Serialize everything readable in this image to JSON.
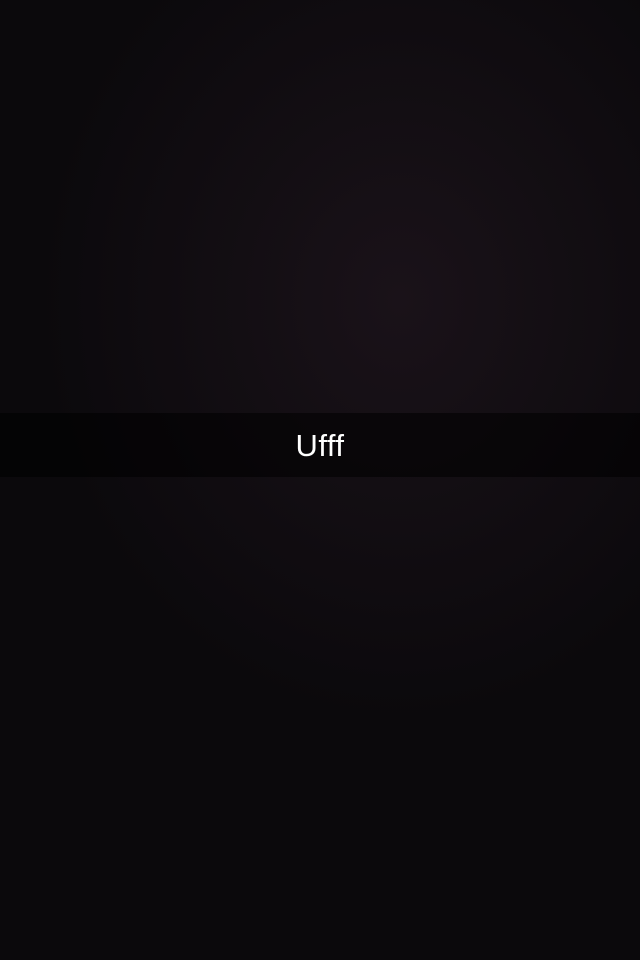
{
  "caption": {
    "text": "Ufff"
  },
  "colors": {
    "background": "#0d0a0e",
    "caption_bar": "#000000",
    "caption_text": "#ffffff"
  }
}
